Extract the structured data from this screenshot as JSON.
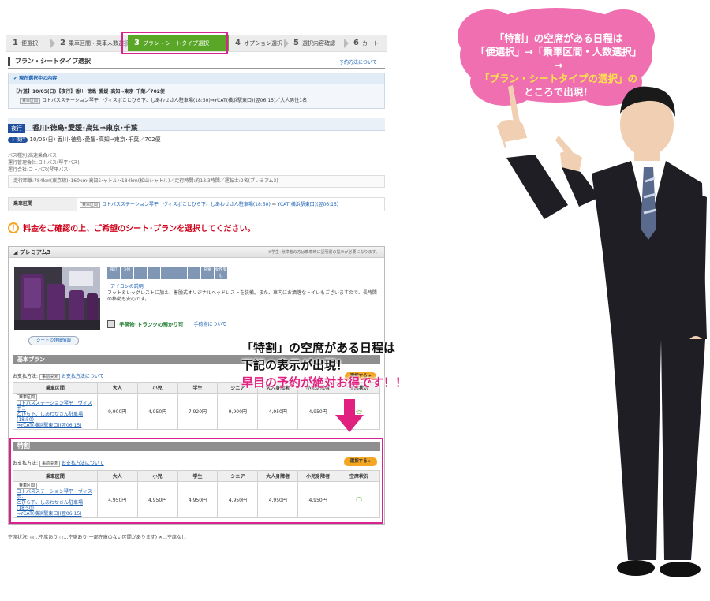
{
  "steps": [
    {
      "num": "1",
      "label": "便選択"
    },
    {
      "num": "2",
      "label": "乗車区間・乗車人数選択"
    },
    {
      "num": "3",
      "label": "プラン・シートタイプ選択"
    },
    {
      "num": "4",
      "label": "オプション選択"
    },
    {
      "num": "5",
      "label": "選択内容確認"
    },
    {
      "num": "6",
      "label": "カート"
    }
  ],
  "section_title": "プラン・シートタイプ選択",
  "plan_link": "予約方法について",
  "current": {
    "header": "現在選択中の内容",
    "line1": "【片道】10/05(日)【夜行】香川･徳島･愛媛･高知⇒東京･千葉／702便",
    "badge": "乗車区間",
    "line2": "コトバスステーション琴平　ヴィスポことひら下、しあわせさん駐車場(18:50)⇒YCAT(横浜駅東口)(翌06:15)／大人男性1名"
  },
  "route": {
    "tag": "夜行",
    "title": "香川･徳島･愛媛･高知⇒東京･千葉"
  },
  "trip": {
    "tag": "夜行",
    "text": "10/05(日)  香川･徳島･愛媛･高知⇒東京･千葉／702便"
  },
  "bus_info": [
    "バス種別:高速乗合バス",
    "運行管理会社:コトバス(琴平バス)",
    "運行会社:コトバス(琴平バス)"
  ],
  "distance": "走行距離:784km(東京線)･160km(高知シャトル)･184km(松山シャトル)／走行時間:約13.3時間／運転士:2名(プレミアム3)",
  "boarding": {
    "label": "乗車区間",
    "badge": "乗車区間",
    "from": "コトバスステーション琴平　ヴィスポことひら下、しあわせさん駐車場(18:50)",
    "to": "YCAT(横浜駅東口)(翌06:15)"
  },
  "warning": "料金をご確認の上、ご希望のシート･プランを選択してください。",
  "seat": {
    "name": "プレミアム3",
    "note": "※学生･身障者の方は乗車時に証明書の提示が必要になります。",
    "icons": [
      "独立",
      "3列",
      "",
      "",
      "",
      "",
      "",
      "充電",
      "女性安心"
    ],
    "icon_link": "アイコンの説明",
    "desc": "フット＆レッグレストに加え、着脱式オリジナルヘッドレストを装備。また、車内にお洒落なトイレもございますので、長時間の移動も安心です。",
    "luggage": "手荷物･トランクの預かり可",
    "luggage_link": "手荷物について",
    "detail_btn": "シートの詳細情報"
  },
  "plans": [
    {
      "title": "基本プラン",
      "pay_label": "お支払方法:",
      "pay_badge": "事前決済",
      "pay_link": "お支払方法について",
      "headers": [
        "乗車区間",
        "大人",
        "小児",
        "学生",
        "シニア",
        "大人身障者",
        "小児身障者",
        "空席状況"
      ],
      "route_badge": "乗車区間",
      "route_lines": [
        "コトバスステーション琴平　ヴィスポこ",
        "とひら下、しあわせさん駐車場(18:50)",
        "⇒YCAT(横浜駅東口)(翌06:15)"
      ],
      "prices": [
        "9,900円",
        "4,950円",
        "7,920円",
        "9,900円",
        "4,950円",
        "4,950円"
      ],
      "status": "◎",
      "select_btn": "選択する"
    },
    {
      "title": "特割",
      "pay_label": "お支払方法:",
      "pay_badge": "事前決済",
      "pay_link": "お支払方法について",
      "headers": [
        "乗車区間",
        "大人",
        "小児",
        "学生",
        "シニア",
        "大人身障者",
        "小児身障者",
        "空席状況"
      ],
      "route_badge": "乗車区間",
      "route_lines": [
        "コトバスステーション琴平　ヴィスポこ",
        "とひら下、しあわせさん駐車場(18:50)",
        "⇒YCAT(横浜駅東口)(翌06:15)"
      ],
      "prices": [
        "4,950円",
        "4,950円",
        "4,950円",
        "4,950円",
        "4,950円",
        "4,950円"
      ],
      "status": "○",
      "select_btn": "選択する"
    }
  ],
  "legend": {
    "label": "空席状況:",
    "items": [
      "◎…空席あり",
      "○…空席あり(一部在庫のない区間があります)",
      "✕…空席なし"
    ]
  },
  "bubble": {
    "lines": [
      "「特割」の空席がある日程は",
      "「便選択」→「乗車区間・人数選択」→",
      "「プラン・シートタイプの選択」の",
      "ところで出現！"
    ]
  },
  "callout": {
    "lines": [
      "「特割」の空席がある日程は",
      "下記の表示が出現！",
      "早目の予約が絶対お得です！！"
    ]
  },
  "colors": {
    "accent": "#5aa728",
    "highlight": "#d9228f",
    "bubble": "#f06fb0",
    "callout_pink": "#e0217f",
    "orange": "#f5a623"
  }
}
